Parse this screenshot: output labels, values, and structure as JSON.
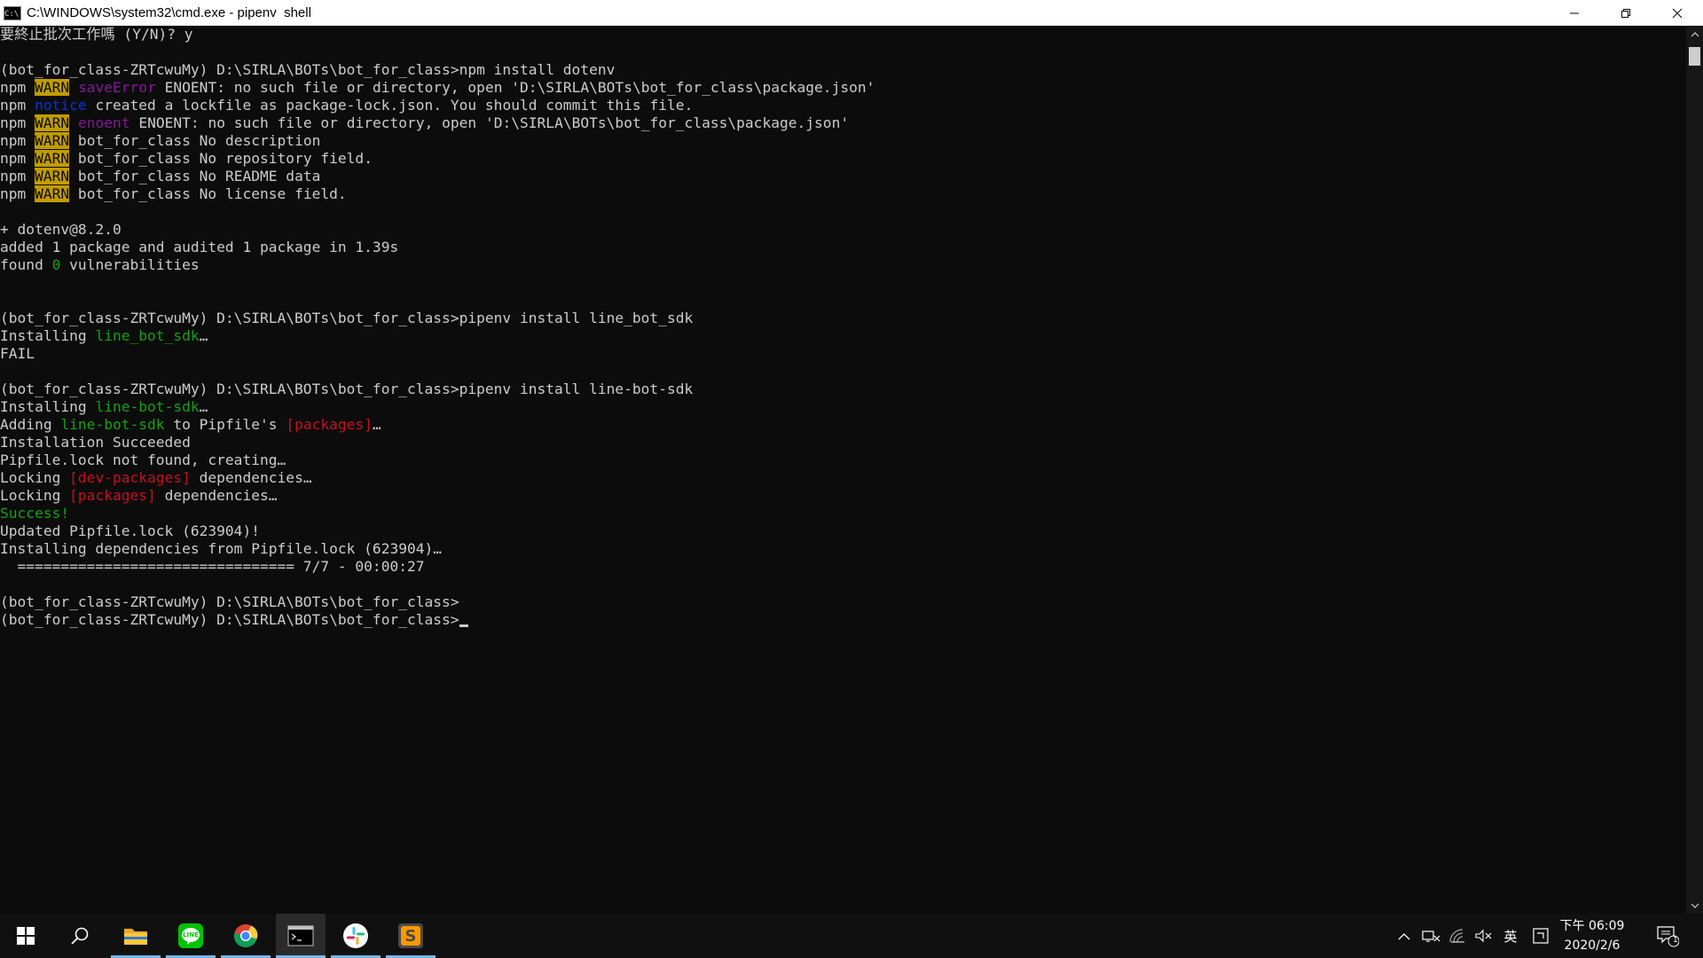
{
  "window": {
    "title": "C:\\WINDOWS\\system32\\cmd.exe - pipenv  shell",
    "icon_label": "C:\\",
    "buttons": [
      "minimize-icon",
      "restore-icon",
      "close-icon"
    ]
  },
  "console": {
    "lines": [
      [
        {
          "t": "要終止批次工作嗎 (Y/N)? y"
        }
      ],
      [
        {
          "t": ""
        }
      ],
      [
        {
          "t": "(bot_for_class-ZRTcwuMy) D:\\SIRLA\\BOTs\\bot_for_class>npm install dotenv"
        }
      ],
      [
        {
          "t": "npm "
        },
        {
          "t": "WARN",
          "c": "warn"
        },
        {
          "t": " "
        },
        {
          "t": "saveError",
          "c": "magenta"
        },
        {
          "t": " ENOENT: no such file or directory, open 'D:\\SIRLA\\BOTs\\bot_for_class\\package.json'"
        }
      ],
      [
        {
          "t": "npm "
        },
        {
          "t": "notice",
          "c": "blue"
        },
        {
          "t": " created a lockfile as package-lock.json. You should commit this file."
        }
      ],
      [
        {
          "t": "npm "
        },
        {
          "t": "WARN",
          "c": "warn"
        },
        {
          "t": " "
        },
        {
          "t": "enoent",
          "c": "magenta"
        },
        {
          "t": " ENOENT: no such file or directory, open 'D:\\SIRLA\\BOTs\\bot_for_class\\package.json'"
        }
      ],
      [
        {
          "t": "npm "
        },
        {
          "t": "WARN",
          "c": "warn"
        },
        {
          "t": " bot_for_class No description"
        }
      ],
      [
        {
          "t": "npm "
        },
        {
          "t": "WARN",
          "c": "warn"
        },
        {
          "t": " bot_for_class No repository field."
        }
      ],
      [
        {
          "t": "npm "
        },
        {
          "t": "WARN",
          "c": "warn"
        },
        {
          "t": " bot_for_class No README data"
        }
      ],
      [
        {
          "t": "npm "
        },
        {
          "t": "WARN",
          "c": "warn"
        },
        {
          "t": " bot_for_class No license field."
        }
      ],
      [
        {
          "t": ""
        }
      ],
      [
        {
          "t": "+ dotenv@8.2.0"
        }
      ],
      [
        {
          "t": "added 1 package and audited 1 package in 1.39s"
        }
      ],
      [
        {
          "t": "found "
        },
        {
          "t": "0",
          "c": "green"
        },
        {
          "t": " vulnerabilities"
        }
      ],
      [
        {
          "t": ""
        }
      ],
      [
        {
          "t": ""
        }
      ],
      [
        {
          "t": "(bot_for_class-ZRTcwuMy) D:\\SIRLA\\BOTs\\bot_for_class>pipenv install line_bot_sdk"
        }
      ],
      [
        {
          "t": "Installing "
        },
        {
          "t": "line_bot_sdk",
          "c": "green"
        },
        {
          "t": "…"
        }
      ],
      [
        {
          "t": "FAIL"
        }
      ],
      [
        {
          "t": ""
        }
      ],
      [
        {
          "t": "(bot_for_class-ZRTcwuMy) D:\\SIRLA\\BOTs\\bot_for_class>pipenv install line-bot-sdk"
        }
      ],
      [
        {
          "t": "Installing "
        },
        {
          "t": "line-bot-sdk",
          "c": "green"
        },
        {
          "t": "…"
        }
      ],
      [
        {
          "t": "Adding "
        },
        {
          "t": "line-bot-sdk",
          "c": "green"
        },
        {
          "t": " to Pipfile's "
        },
        {
          "t": "[packages]",
          "c": "red"
        },
        {
          "t": "…"
        }
      ],
      [
        {
          "t": "Installation Succeeded"
        }
      ],
      [
        {
          "t": "Pipfile.lock not found, creating…"
        }
      ],
      [
        {
          "t": "Locking "
        },
        {
          "t": "[dev-packages]",
          "c": "red"
        },
        {
          "t": " dependencies…"
        }
      ],
      [
        {
          "t": "Locking "
        },
        {
          "t": "[packages]",
          "c": "red"
        },
        {
          "t": " dependencies…"
        }
      ],
      [
        {
          "t": "Success!",
          "c": "green"
        }
      ],
      [
        {
          "t": "Updated Pipfile.lock (623904)!"
        }
      ],
      [
        {
          "t": "Installing dependencies from Pipfile.lock (623904)…"
        }
      ],
      [
        {
          "t": "  ================================ 7/7 - 00:00:27"
        }
      ],
      [
        {
          "t": ""
        }
      ],
      [
        {
          "t": "(bot_for_class-ZRTcwuMy) D:\\SIRLA\\BOTs\\bot_for_class>"
        }
      ],
      [
        {
          "t": "(bot_for_class-ZRTcwuMy) D:\\SIRLA\\BOTs\\bot_for_class>"
        },
        {
          "cursor": true
        }
      ]
    ]
  },
  "taskbar": {
    "apps": [
      {
        "name": "file-explorer",
        "icon": "folder-icon",
        "active": false
      },
      {
        "name": "line",
        "icon": "line-icon",
        "label": "LINE",
        "active": false
      },
      {
        "name": "chrome",
        "icon": "chrome-icon",
        "active": false
      },
      {
        "name": "command-prompt",
        "icon": "terminal-icon",
        "active": true
      },
      {
        "name": "slack",
        "icon": "slack-icon",
        "active": false
      },
      {
        "name": "sublime-text",
        "icon": "sublime-icon",
        "label": "S",
        "active": false
      }
    ],
    "tray": {
      "chevron": "^",
      "ime_mode": "英",
      "time": "下午 06:09",
      "date": "2020/2/6",
      "notification_count": "1"
    }
  },
  "colors": {
    "console_bg": "#0c0c0c",
    "console_fg": "#cccccc",
    "warn_bg": "#c19c00",
    "magenta": "#881798",
    "blue": "#0037da",
    "green": "#13a10e",
    "red": "#c50f1f",
    "taskbar_bg": "#101010",
    "active_underline": "#76b9ed"
  }
}
